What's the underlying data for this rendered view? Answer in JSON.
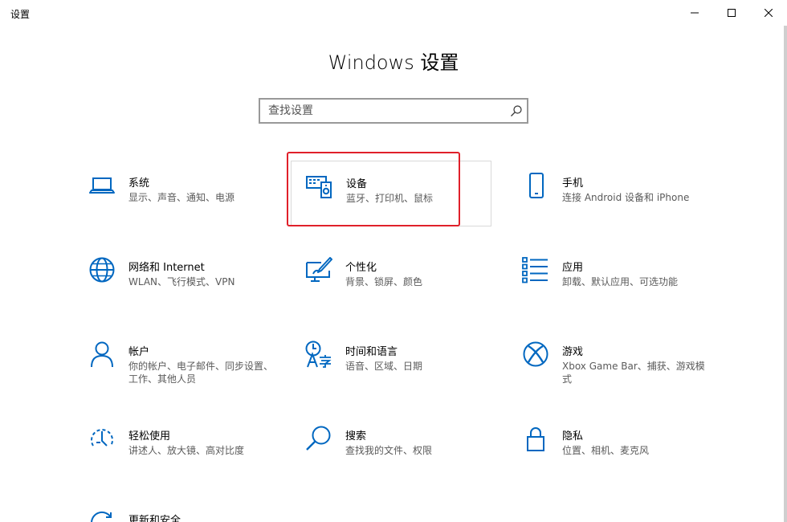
{
  "window": {
    "title": "设置",
    "controls": {
      "minimize": "minimize",
      "maximize": "maximize",
      "close": "close"
    }
  },
  "page": {
    "title": "Windows 设置"
  },
  "search": {
    "placeholder": "查找设置",
    "value": ""
  },
  "colors": {
    "accent": "#0067c0",
    "highlight_box": "#e0202a",
    "secondary_text": "#5a5a5a"
  },
  "tiles": [
    {
      "label": "系统",
      "desc": "显示、声音、通知、电源",
      "icon": "laptop-icon"
    },
    {
      "label": "设备",
      "desc": "蓝牙、打印机、鼠标",
      "icon": "devices-icon"
    },
    {
      "label": "手机",
      "desc": "连接 Android 设备和 iPhone",
      "icon": "phone-icon"
    },
    {
      "label": "网络和 Internet",
      "desc": "WLAN、飞行模式、VPN",
      "icon": "globe-icon"
    },
    {
      "label": "个性化",
      "desc": "背景、锁屏、颜色",
      "icon": "personalization-icon"
    },
    {
      "label": "应用",
      "desc": "卸载、默认应用、可选功能",
      "icon": "apps-list-icon"
    },
    {
      "label": "帐户",
      "desc": "你的帐户、电子邮件、同步设置、工作、其他人员",
      "icon": "person-icon"
    },
    {
      "label": "时间和语言",
      "desc": "语音、区域、日期",
      "icon": "time-language-icon"
    },
    {
      "label": "游戏",
      "desc": "Xbox Game Bar、捕获、游戏模式",
      "icon": "xbox-icon"
    },
    {
      "label": "轻松使用",
      "desc": "讲述人、放大镜、高对比度",
      "icon": "ease-of-access-icon"
    },
    {
      "label": "搜索",
      "desc": "查找我的文件、权限",
      "icon": "search-magnifier-icon"
    },
    {
      "label": "隐私",
      "desc": "位置、相机、麦克风",
      "icon": "lock-icon"
    },
    {
      "label": "更新和安全",
      "icon": "update-icon"
    }
  ]
}
